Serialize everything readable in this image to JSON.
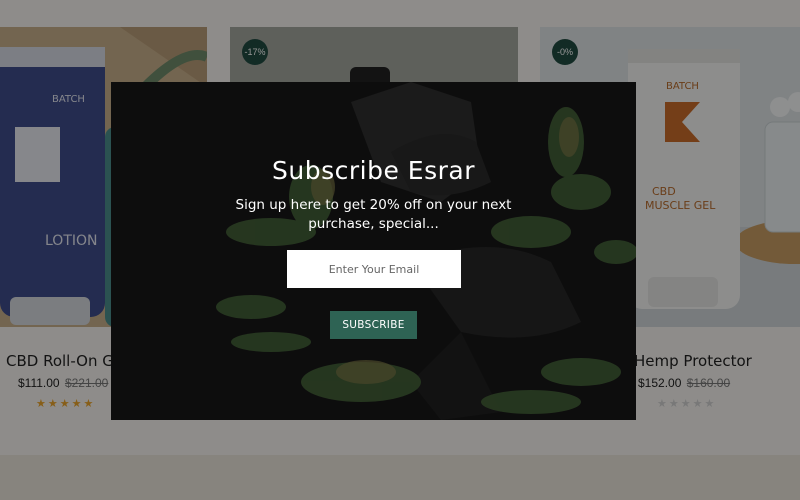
{
  "products": [
    {
      "name": "CBD Roll-On Ge",
      "price": "$111.00",
      "old_price": "$221.00",
      "rating_stars": "★★★★★",
      "rating": 5,
      "tube_label": "LOTION",
      "brand": "BATCH"
    },
    {
      "discount_badge": "-17%"
    },
    {
      "name": "Hemp Protector",
      "price": "$152.00",
      "old_price": "$160.00",
      "rating_stars": "★★★★★",
      "rating": 0,
      "discount_badge": "-0%",
      "tube_label": "CBD MUSCLE GEL",
      "brand": "BATCH"
    }
  ],
  "popup": {
    "title": "Subscribe Esrar",
    "subtitle": "Sign up here to get 20% off on your next purchase, special...",
    "email_placeholder": "Enter Your Email",
    "button_label": "SUBSCRIBE"
  },
  "colors": {
    "popup_button": "#2e6354",
    "badge": "#1f4a41",
    "star_active": "#e8a22a",
    "star_inactive": "#cfcfcf"
  }
}
